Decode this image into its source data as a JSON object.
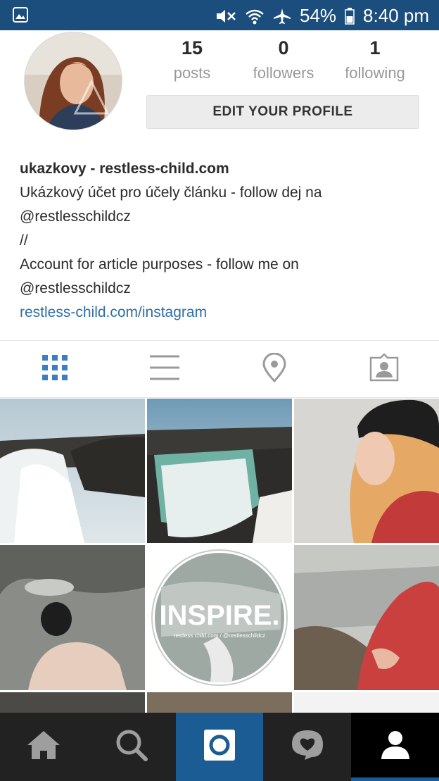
{
  "status_bar": {
    "battery": "54%",
    "time": "8:40 pm",
    "colors": {
      "bar": "#1b4d7d"
    }
  },
  "profile": {
    "stats": [
      {
        "value": "15",
        "label": "posts"
      },
      {
        "value": "0",
        "label": "followers"
      },
      {
        "value": "1",
        "label": "following"
      }
    ],
    "edit_button_label": "EDIT YOUR PROFILE",
    "name": "ukazkovy - restless-child.com",
    "bio_lines": [
      "Ukázkový účet pro účely článku - follow dej na",
      "@restlesschildcz",
      "//",
      "Account for article purposes - follow me on",
      "@restlesschildcz"
    ],
    "website": "restless-child.com/instagram"
  },
  "view_tabs": [
    {
      "icon": "grid-icon",
      "active": true
    },
    {
      "icon": "list-icon",
      "active": false
    },
    {
      "icon": "location-pin-icon",
      "active": false
    },
    {
      "icon": "tagged-photos-icon",
      "active": false
    }
  ],
  "posts": [
    {
      "kind": "waterfall"
    },
    {
      "kind": "waterfall"
    },
    {
      "kind": "woman-in-hat"
    },
    {
      "kind": "hand-with-stone"
    },
    {
      "kind": "inspire-badge",
      "caption": "INSPIRE.",
      "subcaption": "restless child.com / @restlesschildcz"
    },
    {
      "kind": "woman-red-blanket"
    }
  ],
  "bottom_nav": [
    {
      "icon": "home-icon"
    },
    {
      "icon": "search-icon"
    },
    {
      "icon": "camera-icon",
      "active": true
    },
    {
      "icon": "activity-heart-icon"
    },
    {
      "icon": "profile-icon",
      "active": true
    }
  ],
  "colors": {
    "accent": "#3a7fc1",
    "link": "#2f6fa7",
    "nav_active": "#1a5c93"
  }
}
